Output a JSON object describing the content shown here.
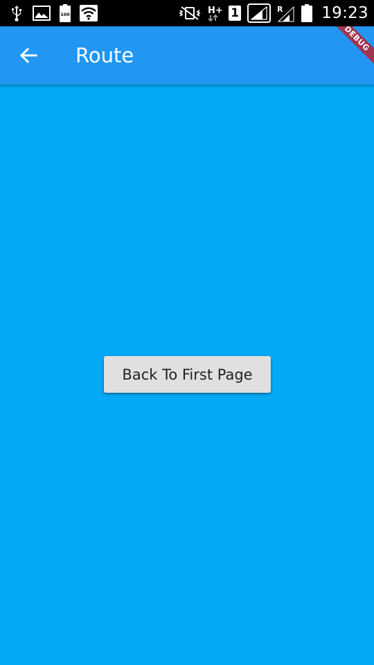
{
  "status_bar": {
    "time": "19:23",
    "left_icons": [
      "usb-icon",
      "gallery-icon",
      "battery-100-icon",
      "wifi-icon"
    ],
    "right_icons": [
      "vibrate-icon",
      "network-hplus-icon",
      "sim-1-icon",
      "signal-icon",
      "roaming-signal-icon",
      "battery-icon"
    ],
    "battery_badge": "100",
    "network_type": "H+",
    "sim_number": "1",
    "roaming_label": "R"
  },
  "app_bar": {
    "title": "Route",
    "color": "#2196f3"
  },
  "debug_banner": {
    "label": "DEBUG"
  },
  "body": {
    "background": "#03a9f4",
    "button_label": "Back To First Page"
  }
}
